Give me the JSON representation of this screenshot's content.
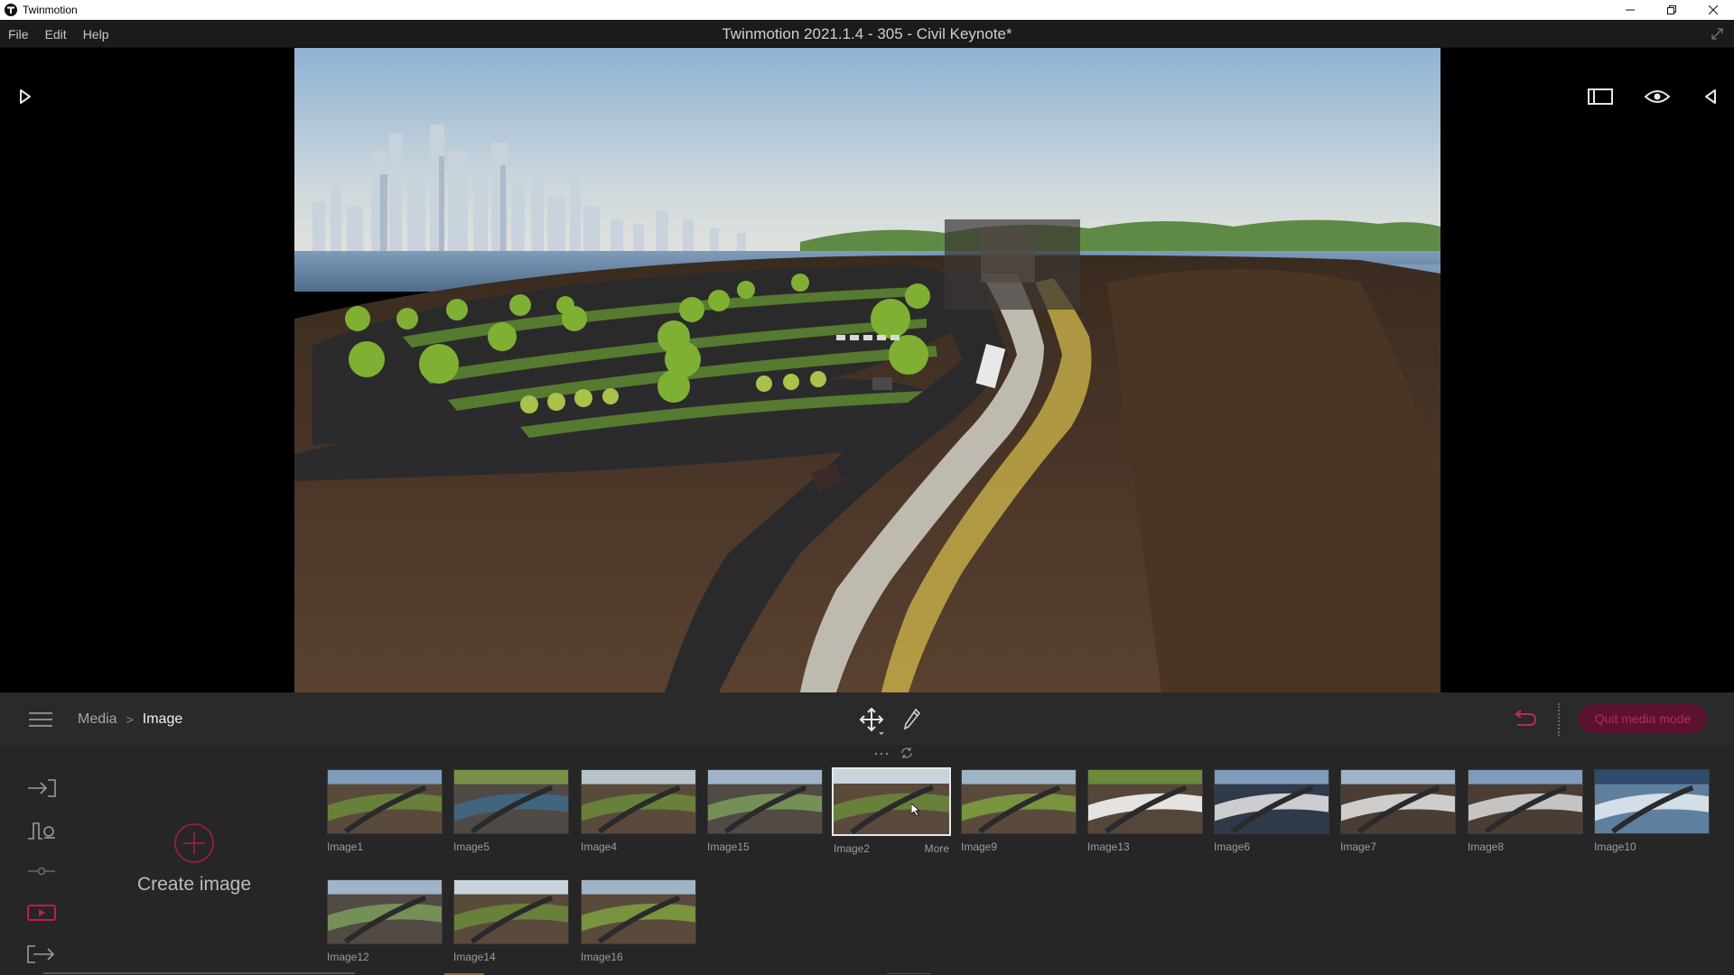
{
  "window": {
    "title": "Twinmotion",
    "controls": [
      "minimize",
      "restore",
      "close"
    ]
  },
  "menubar": {
    "items": [
      "File",
      "Edit",
      "Help"
    ],
    "project_title": "Twinmotion 2021.1.4 - 305 - Civil Keynote*"
  },
  "viewport": {
    "left_toggle_icon": "play-right-icon",
    "right_icons": [
      "aspect-frame-icon",
      "eye-icon",
      "collapse-left-icon"
    ]
  },
  "panel": {
    "breadcrumb": {
      "parent": "Media",
      "separator": ">",
      "current": "Image"
    },
    "tools": [
      "move-gizmo-icon",
      "eyedropper-icon"
    ],
    "undo_icon": "undo-icon",
    "quit_button": "Quit media mode",
    "side_tools": [
      "import-icon",
      "context-icon",
      "configure-icon",
      "media-icon",
      "export-icon"
    ],
    "create_image_label": "Create image",
    "more_label": "More",
    "thumbnails_row1": [
      "Image1",
      "Image5",
      "Image4",
      "Image15",
      "Image2",
      "Image9",
      "Image13",
      "Image6",
      "Image7",
      "Image8",
      "Image10"
    ],
    "thumbnails_row2": [
      "Image12",
      "Image14",
      "Image16"
    ],
    "selected": "Image2"
  },
  "colors": {
    "accent_pink": "#c2185b",
    "quit_bg": "#5a1230",
    "panel_bg": "#262626",
    "header_bg": "#2a2a2a"
  }
}
